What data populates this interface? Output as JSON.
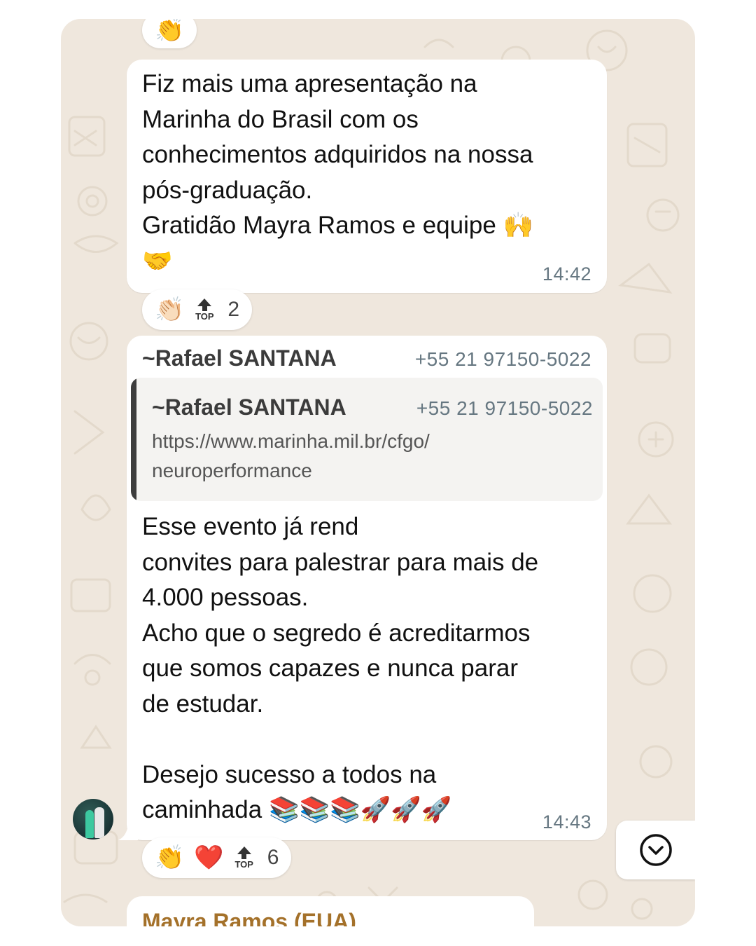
{
  "top_reaction": {
    "emoji": "👏"
  },
  "message1": {
    "text": "Fiz mais uma apresentação na\nMarinha do Brasil com os\nconhecimentos adquiridos na nossa\npós-graduação.\nGratidão Mayra Ramos e equipe 🙌\n🤝",
    "time": "14:42",
    "reactions": {
      "emoji": "👏🏻",
      "top_label": "TOP",
      "count": "2"
    }
  },
  "message2": {
    "sender_tilde": "~",
    "sender": "Rafael SANTANA",
    "phone": "+55 21 97150-5022",
    "quote": {
      "sender_tilde": "~",
      "sender": "Rafael SANTANA",
      "phone": "+55 21 97150-5022",
      "text": "https://www.marinha.mil.br/cfgo/\nneuroperformance"
    },
    "text": "Esse evento já rend\nconvites para palestrar para mais de\n4.000 pessoas.\nAcho que o segredo é acreditarmos\nque somos capazes e nunca parar\nde estudar.\n\nDesejo sucesso a todos na\ncaminhada 📚📚📚🚀🚀🚀",
    "time": "14:43",
    "reactions": {
      "emoji1": "👏",
      "emoji2": "❤️",
      "top_label": "TOP",
      "count": "6"
    }
  },
  "next_message": {
    "sender": "Mayra Ramos (EUA)"
  },
  "icons": {
    "scroll_down": "chevron-down-circle-icon",
    "avatar": "avatar"
  },
  "colors": {
    "background": "#efe7dd",
    "bubble": "#ffffff",
    "next_sender": "#a4712a",
    "time": "#667781"
  }
}
